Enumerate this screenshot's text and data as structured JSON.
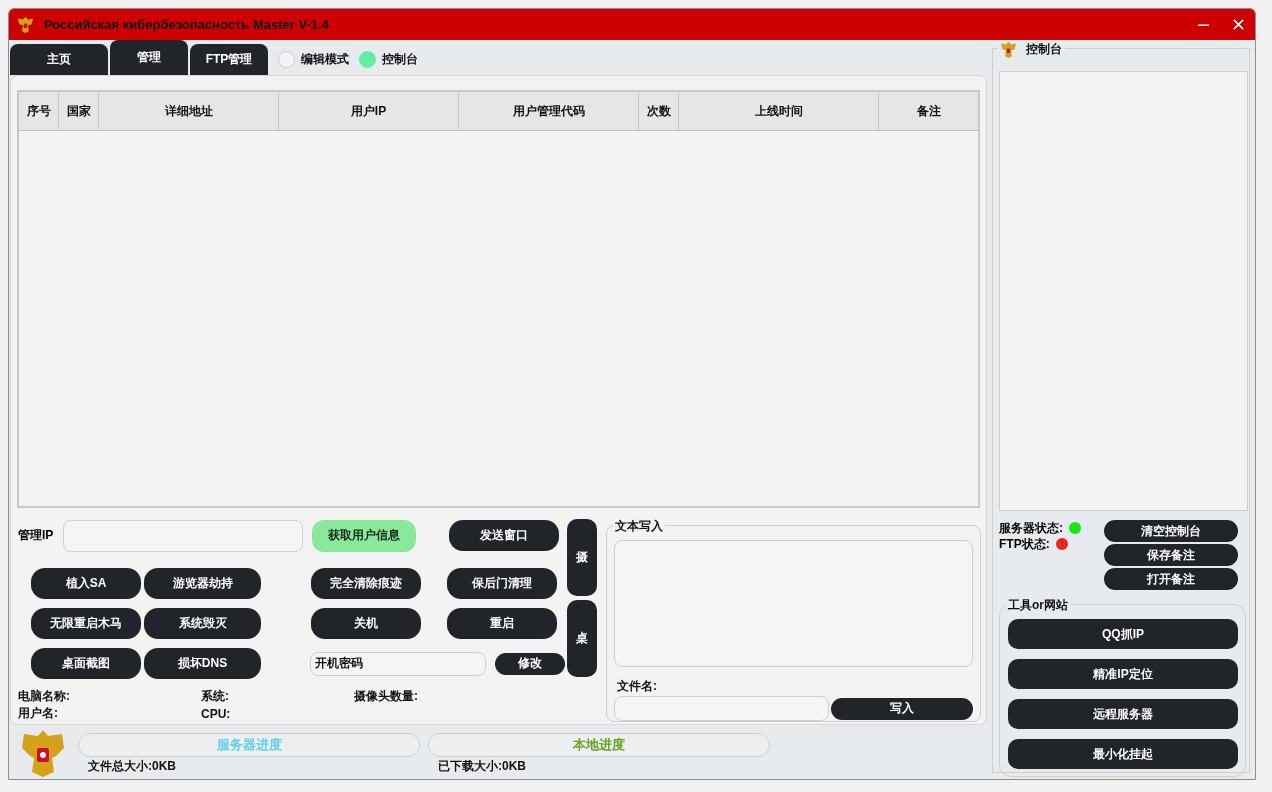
{
  "window": {
    "title": "Российская кибербезопасность Master V-1.4"
  },
  "tabs": [
    {
      "label": "主页",
      "selected": false
    },
    {
      "label": "管理",
      "selected": true
    },
    {
      "label": "FTP管理",
      "selected": false
    }
  ],
  "modes": [
    {
      "label": "编辑模式",
      "selected": false
    },
    {
      "label": "控制台",
      "selected": true
    }
  ],
  "table": {
    "columns": [
      "序号",
      "国家",
      "详细地址",
      "用户IP",
      "用户管理代码",
      "次数",
      "上线时间",
      "备注"
    ]
  },
  "controls": {
    "ip_label": "管理IP",
    "fetch_button": "获取用户信息",
    "send_button": "发送窗口",
    "left_buttons": [
      [
        "植入SA",
        "游览器劫持"
      ],
      [
        "无限重启木马",
        "系统毁灭"
      ],
      [
        "桌面截图",
        "损坏DNS"
      ]
    ],
    "right_buttons": [
      [
        "完全清除痕迹",
        "保后门清理"
      ],
      [
        "关机",
        "重启"
      ]
    ],
    "password_value": "开机密码",
    "modify_button": "修改",
    "side_buttons": [
      "摄",
      "桌"
    ]
  },
  "info": [
    [
      "电脑名称:",
      "系统:",
      "摄像头数量:"
    ],
    [
      "用户名:",
      "CPU:"
    ]
  ],
  "text_write": {
    "title": "文本写入",
    "filename_label": "文件名:",
    "write_button": "写入"
  },
  "console": {
    "title": "控制台",
    "status": [
      {
        "label": "服务器状态:",
        "color": "#19e619"
      },
      {
        "label": "FTP状态:",
        "color": "#f0261a"
      }
    ],
    "buttons": [
      "清空控制台",
      "保存备注",
      "打开备注"
    ]
  },
  "tools": {
    "title": "工具or网站",
    "buttons": [
      "QQ抓IP",
      "精准IP定位",
      "远程服务器",
      "最小化挂起"
    ]
  },
  "progress": [
    {
      "label": "服务器进度",
      "color": "#5fd0e8",
      "size": "文件总大小:0KB"
    },
    {
      "label": "本地进度",
      "color": "#6aa121",
      "size": "已下载大小:0KB"
    }
  ]
}
